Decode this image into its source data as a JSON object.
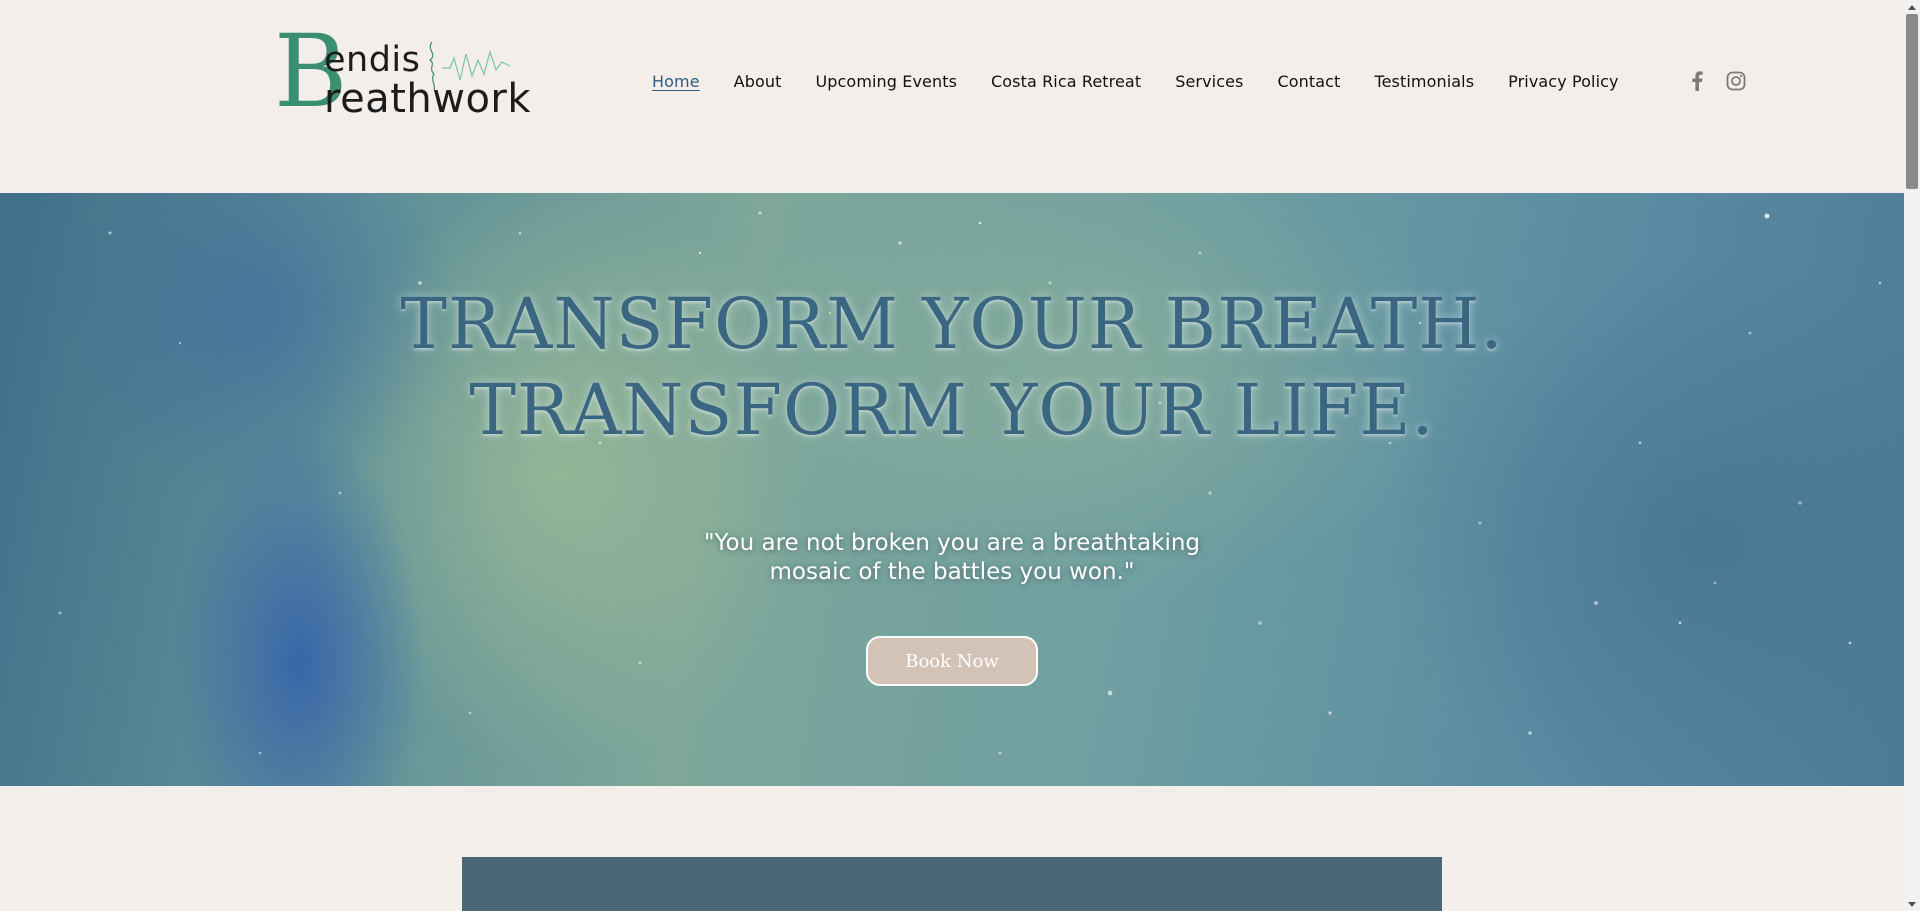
{
  "brand": {
    "logo_initial": "B",
    "logo_line1": "endis",
    "logo_line2": "reathwork",
    "logo_alt": "Bendis Breathwork"
  },
  "nav": {
    "items": [
      {
        "label": "Home",
        "active": true
      },
      {
        "label": "About"
      },
      {
        "label": "Upcoming Events"
      },
      {
        "label": "Costa Rica Retreat"
      },
      {
        "label": "Services"
      },
      {
        "label": "Contact"
      },
      {
        "label": "Testimonials"
      },
      {
        "label": "Privacy Policy"
      }
    ]
  },
  "social": {
    "icons": [
      "facebook-icon",
      "instagram-icon"
    ],
    "icon_color": "#7a7a7a"
  },
  "hero": {
    "title_line1": "TRANSFORM YOUR BREATH.",
    "title_line2": "TRANSFORM YOUR LIFE.",
    "quote_line1": "\"You are not broken you are a breathtaking",
    "quote_line2": "mosaic of the battles you won.\"",
    "cta_label": "Book Now"
  },
  "colors": {
    "page_bg": "#f3eeea",
    "accent_green": "#3a8f72",
    "nav_active": "#2f5f80",
    "hero_title": "#3b6682",
    "button_bg": "#d3c2b6",
    "panel": "#4a6574"
  }
}
